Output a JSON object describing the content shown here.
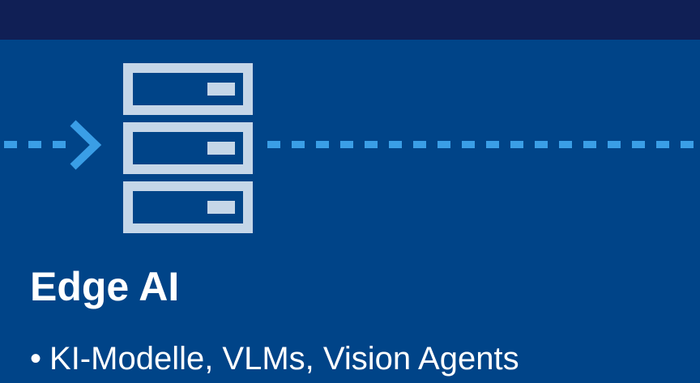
{
  "colors": {
    "background": "#004488",
    "top_bar": "#101f55",
    "flow_line": "#3a9ee6",
    "server_icon": "#c5d6e8",
    "text": "#ffffff"
  },
  "icons": {
    "arrow": "arrow-right-icon",
    "server": "server-rack-icon"
  },
  "section": {
    "title": "Edge AI",
    "bullet_symbol": "•",
    "bullets": [
      "KI-Modelle, VLMs, Vision Agents"
    ]
  }
}
